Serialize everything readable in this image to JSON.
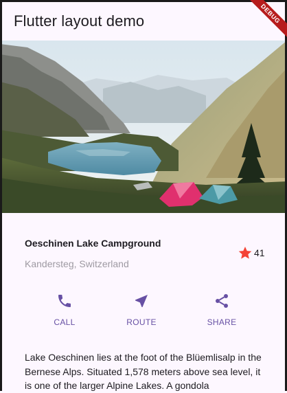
{
  "appbar": {
    "title": "Flutter layout demo"
  },
  "banner": {
    "label": "DEBUG"
  },
  "place": {
    "name": "Oeschinen Lake Campground",
    "location": "Kandersteg, Switzerland",
    "rating_count": "41"
  },
  "actions": [
    {
      "label": "CALL",
      "icon": "phone-icon"
    },
    {
      "label": "ROUTE",
      "icon": "near-me-icon"
    },
    {
      "label": "SHARE",
      "icon": "share-icon"
    }
  ],
  "description": "Lake Oeschinen lies at the foot of the Blüemlisalp in the Bernese Alps. Situated 1,578 meters above sea level, it is one of the larger Alpine Lakes. A gondola",
  "colors": {
    "accent": "#6750a4",
    "star": "#f44336",
    "background": "#fdf7ff",
    "debug_ribbon": "#b71c1c"
  }
}
